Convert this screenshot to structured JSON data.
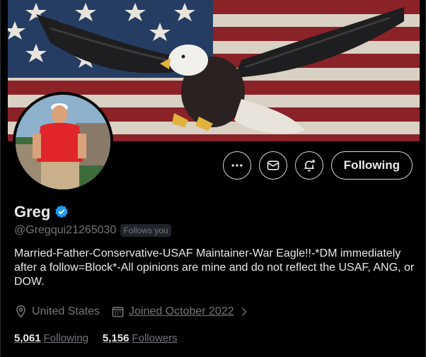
{
  "profile": {
    "display_name": "Greg",
    "handle": "@Gregqui21265030",
    "follows_you": "Follows you",
    "bio": "Married-Father-Conservative-USAF Maintainer-War Eagle!!-*DM immediately after a follow=Block*-All opinions are mine and do not reflect the USAF, ANG, or DOW.",
    "location": "United States",
    "joined": "Joined October 2022"
  },
  "actions": {
    "more_icon": "more-icon",
    "message_icon": "envelope-icon",
    "notify_icon": "bell-plus-icon",
    "follow_label": "Following"
  },
  "stats": {
    "following_count": "5,061",
    "following_label": "Following",
    "followers_count": "5,156",
    "followers_label": "Followers"
  },
  "colors": {
    "background": "#000000",
    "text": "#e7e9ea",
    "muted": "#71767b",
    "verified": "#1d9bf0",
    "border": "#cfd9de"
  }
}
